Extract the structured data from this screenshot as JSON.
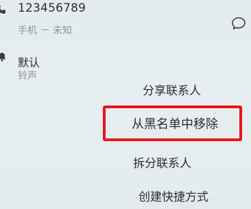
{
  "contact": {
    "phone_number": "123456789",
    "phone_label": "手机 － 未知",
    "phone_icon": "phone-icon",
    "message_icon": "message-icon"
  },
  "ringtone": {
    "icon": "bell-icon",
    "value": "默认",
    "label": "铃声"
  },
  "menu": {
    "items": [
      {
        "label": "分享联系人"
      },
      {
        "label": "从黑名单中移除",
        "highlighted": true
      },
      {
        "label": "拆分联系人"
      },
      {
        "label": "创建快捷方式"
      }
    ]
  },
  "colors": {
    "highlight": "#e8141a",
    "background": "#e4ecee",
    "secondary_text": "#8c9498"
  }
}
